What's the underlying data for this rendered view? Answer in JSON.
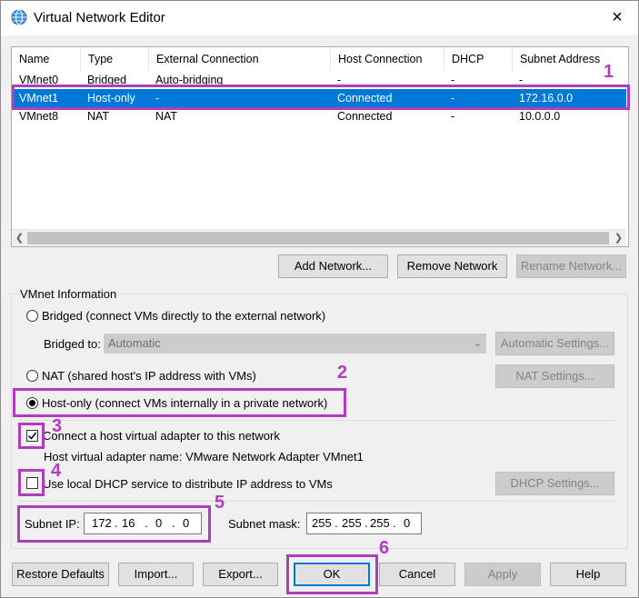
{
  "window": {
    "title": "Virtual Network Editor",
    "close_icon": "×"
  },
  "table": {
    "columns": [
      "Name",
      "Type",
      "External Connection",
      "Host Connection",
      "DHCP",
      "Subnet Address"
    ],
    "rows": [
      [
        "VMnet0",
        "Bridged",
        "Auto-bridging",
        "-",
        "-",
        "-"
      ],
      [
        "VMnet1",
        "Host-only",
        "-",
        "Connected",
        "-",
        "172.16.0.0"
      ],
      [
        "VMnet8",
        "NAT",
        "NAT",
        "Connected",
        "-",
        "10.0.0.0"
      ]
    ],
    "selected_row": 1
  },
  "list_buttons": {
    "add": "Add Network...",
    "remove": "Remove Network",
    "rename": "Rename Network..."
  },
  "info": {
    "group_title": "VMnet Information",
    "bridged_label": "Bridged (connect VMs directly to the external network)",
    "bridged_to_label": "Bridged to:",
    "bridged_to_value": "Automatic",
    "auto_settings": "Automatic Settings...",
    "nat_label": "NAT (shared host's IP address with VMs)",
    "nat_settings": "NAT Settings...",
    "hostonly_label": "Host-only (connect VMs internally in a private network)",
    "selected_mode": "Host-only",
    "connect_adapter_label": "Connect a host virtual adapter to this network",
    "connect_adapter_checked": true,
    "adapter_name_label": "Host virtual adapter name: VMware Network Adapter VMnet1",
    "dhcp_label": "Use local DHCP service to distribute IP address to VMs",
    "dhcp_checked": false,
    "dhcp_settings": "DHCP Settings...",
    "subnet_ip_label": "Subnet IP:",
    "subnet_ip": [
      "172",
      "16",
      "0",
      "0"
    ],
    "subnet_mask_label": "Subnet mask:",
    "subnet_mask": [
      "255",
      "255",
      "255",
      "0"
    ]
  },
  "bottom_buttons": {
    "restore": "Restore Defaults",
    "import": "Import...",
    "export": "Export...",
    "ok": "OK",
    "cancel": "Cancel",
    "apply": "Apply",
    "help": "Help"
  },
  "annotations": [
    "1",
    "2",
    "3",
    "4",
    "5",
    "6"
  ],
  "colors": {
    "selection": "#0078d7",
    "annotation": "#b03cbe"
  }
}
